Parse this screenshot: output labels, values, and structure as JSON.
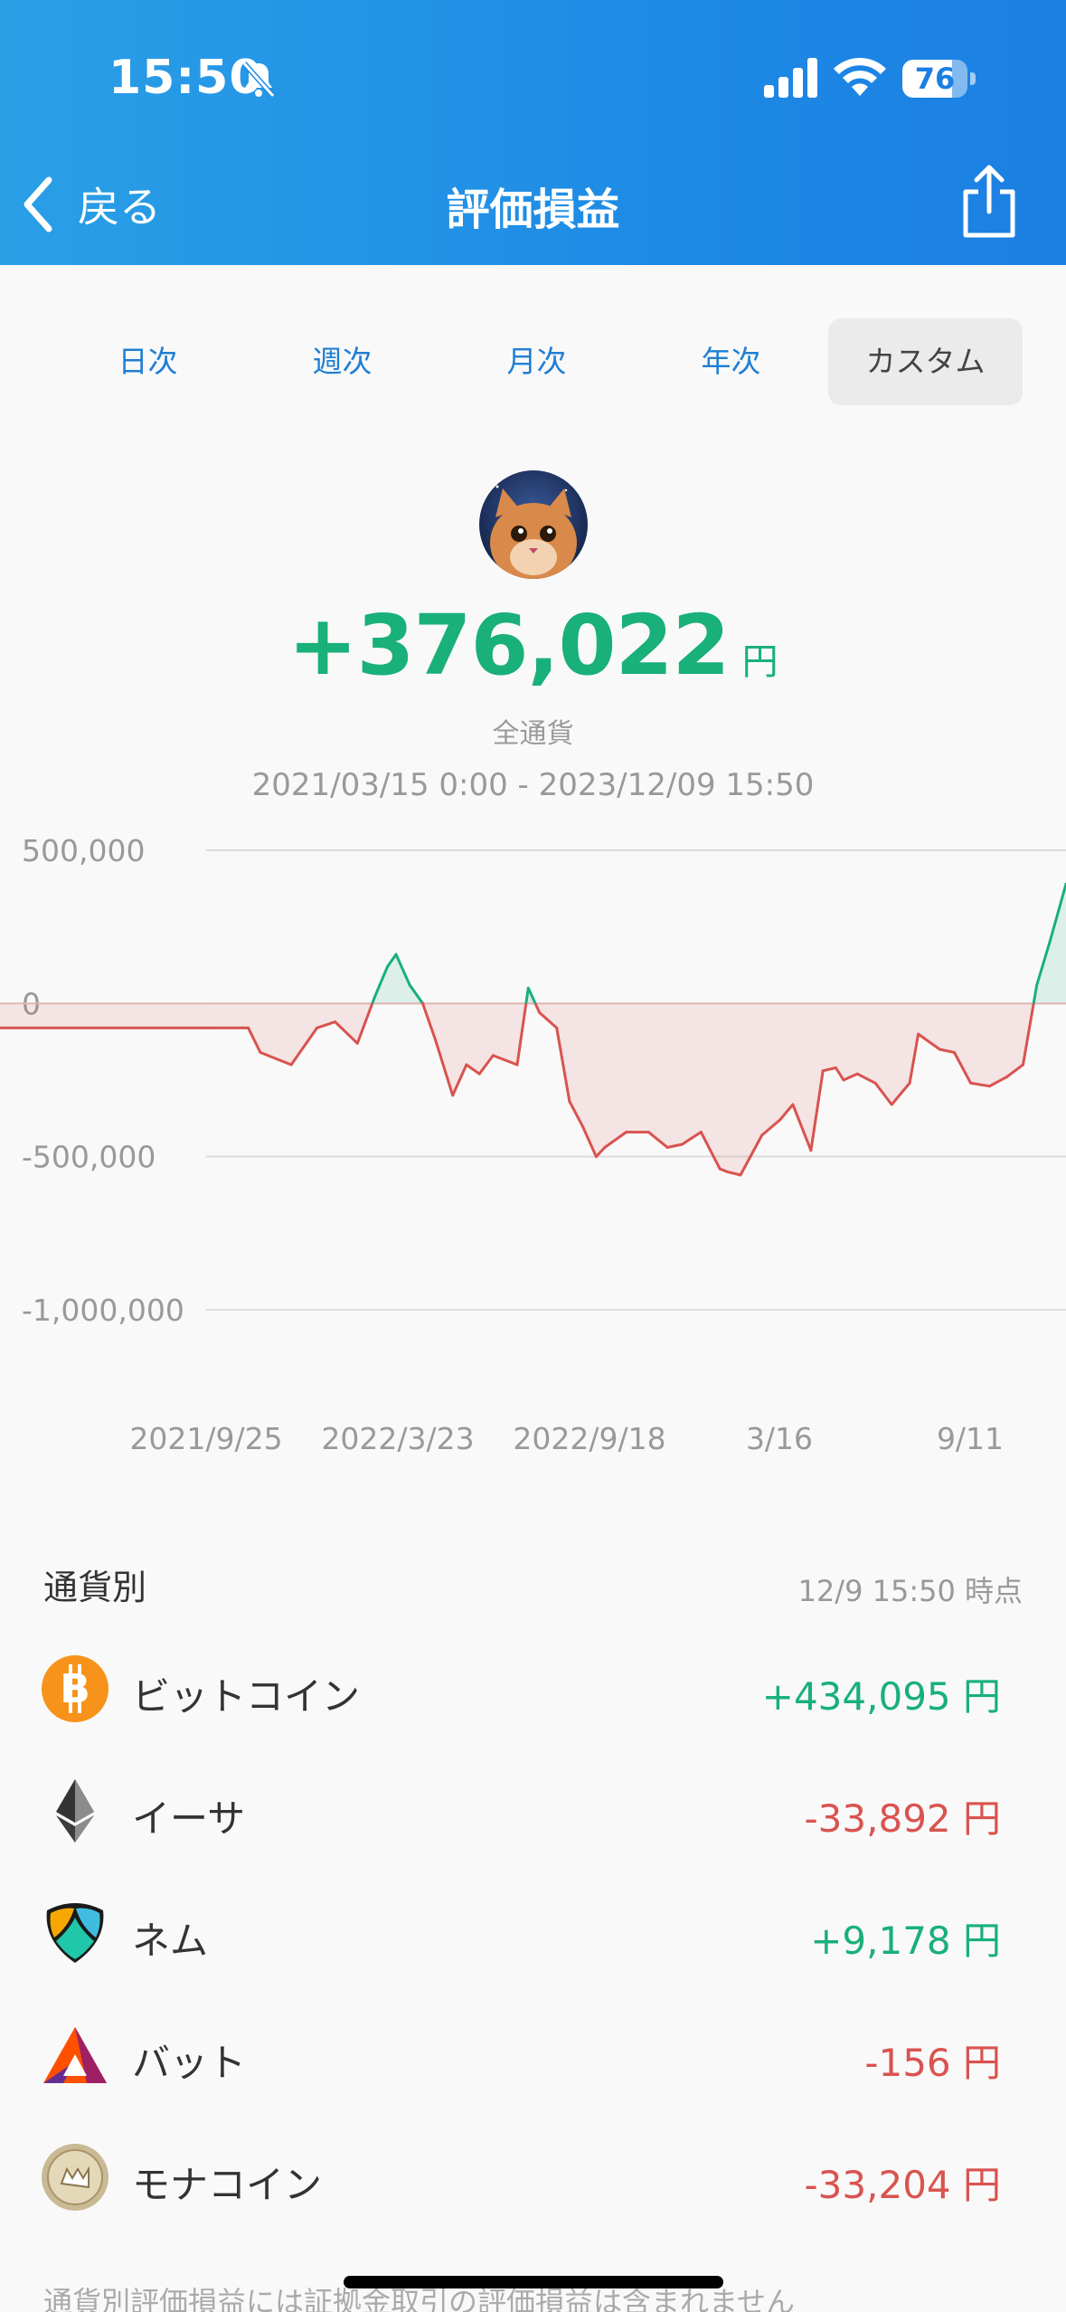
{
  "status_bar": {
    "time": "15:50",
    "battery": "76",
    "battery_level": 0.76
  },
  "nav": {
    "back_label": "戻る",
    "title": "評価損益"
  },
  "tabs": [
    {
      "label": "日次",
      "active": false
    },
    {
      "label": "週次",
      "active": false
    },
    {
      "label": "月次",
      "active": false
    },
    {
      "label": "年次",
      "active": false
    },
    {
      "label": "カスタム",
      "active": true
    }
  ],
  "summary": {
    "total": "+376,022",
    "unit": "円",
    "scope": "全通貨",
    "period": "2021/03/15 0:00 - 2023/12/09 15:50"
  },
  "colors": {
    "gain": "#19b07a",
    "loss": "#d9534f",
    "header": "#1e8be5"
  },
  "chart_data": {
    "type": "area",
    "y_ticks": [
      "500,000",
      "0",
      "-500,000",
      "-1,000,000"
    ],
    "ylim": [
      -1000000,
      500000
    ],
    "x_ticks": [
      "2021/9/25",
      "2022/3/23",
      "2022/9/18",
      "3/16",
      "9/11"
    ],
    "xlim": [
      "2021/03/15",
      "2023/12/09"
    ],
    "grid": true,
    "series": [
      {
        "x": [
          "2021/03/15",
          "2021/05/01",
          "2021/05/15",
          "2021/06/20",
          "2021/07/20",
          "2021/08/10",
          "2021/09/05",
          "2021/09/25",
          "2021/10/10",
          "2021/10/20",
          "2021/11/05",
          "2021/11/20",
          "2021/12/05",
          "2021/12/25",
          "2022/01/10",
          "2022/01/25",
          "2022/02/10",
          "2022/03/10",
          "2022/03/23",
          "2022/04/05",
          "2022/04/25",
          "2022/05/10",
          "2022/05/25",
          "2022/06/10",
          "2022/06/20",
          "2022/07/15",
          "2022/08/10",
          "2022/09/01",
          "2022/09/18",
          "2022/10/10",
          "2022/11/01",
          "2022/11/10",
          "2022/11/25",
          "2022/12/20",
          "2023/01/10",
          "2023/01/25",
          "2023/02/15",
          "2023/03/01",
          "2023/03/16",
          "2023/03/25",
          "2023/04/10",
          "2023/05/01",
          "2023/05/20",
          "2023/06/10",
          "2023/06/20",
          "2023/07/15",
          "2023/08/01",
          "2023/08/20",
          "2023/09/11",
          "2023/10/01",
          "2023/10/20",
          "2023/11/05",
          "2023/11/20",
          "2023/12/09"
        ],
        "values": [
          -80000,
          -80000,
          -160000,
          -200000,
          -80000,
          -60000,
          -130000,
          20000,
          120000,
          160000,
          60000,
          0,
          -120000,
          -300000,
          -200000,
          -230000,
          -170000,
          -200000,
          50000,
          -30000,
          -80000,
          -320000,
          -400000,
          -500000,
          -470000,
          -420000,
          -420000,
          -470000,
          -460000,
          -420000,
          -540000,
          -550000,
          -560000,
          -430000,
          -380000,
          -330000,
          -480000,
          -220000,
          -210000,
          -250000,
          -230000,
          -260000,
          -330000,
          -260000,
          -100000,
          -150000,
          -160000,
          -260000,
          -270000,
          -240000,
          -200000,
          60000,
          200000,
          390000
        ]
      }
    ]
  },
  "by_currency": {
    "title": "通貨別",
    "as_of": "12/9 15:50 時点",
    "items": [
      {
        "name": "ビットコイン",
        "value": "+434,095 円",
        "sign": "pos",
        "icon": "bitcoin-icon"
      },
      {
        "name": "イーサ",
        "value": "-33,892 円",
        "sign": "neg",
        "icon": "ethereum-icon"
      },
      {
        "name": "ネム",
        "value": "+9,178 円",
        "sign": "pos",
        "icon": "nem-icon"
      },
      {
        "name": "バット",
        "value": "-156 円",
        "sign": "neg",
        "icon": "bat-icon"
      },
      {
        "name": "モナコイン",
        "value": "-33,204 円",
        "sign": "neg",
        "icon": "monacoin-icon"
      }
    ],
    "footnote": "通貨別評価損益には証拠金取引の評価損益は含まれません"
  }
}
